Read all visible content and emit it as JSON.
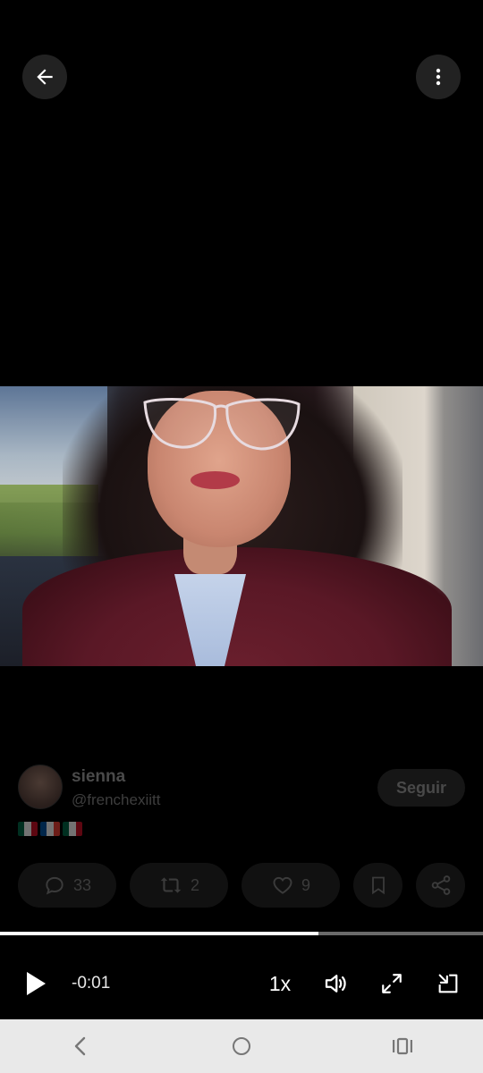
{
  "author": {
    "name": "sienna",
    "handle": "@frenchexiitt",
    "follow_label": "Seguir"
  },
  "bio_flags": [
    "flag-mexico",
    "flag-france",
    "flag-mexico"
  ],
  "actions": {
    "replies": "33",
    "reposts": "2",
    "likes": "9"
  },
  "player": {
    "time_remaining": "-0:01",
    "speed": "1x",
    "progress": 0.66
  },
  "icons": {
    "back": "arrow-left-icon",
    "more": "more-vertical-icon",
    "reply": "comment-icon",
    "repost": "repost-icon",
    "like": "heart-icon",
    "bookmark": "bookmark-icon",
    "share": "share-icon",
    "play": "play-icon",
    "volume": "volume-icon",
    "fullscreen": "fullscreen-icon",
    "pip": "picture-in-picture-icon"
  },
  "colors": {
    "background": "#000000",
    "nav_bar": "#e9e9e9",
    "progress_fill": "#ffffff",
    "progress_track": "#6a6a6a"
  }
}
